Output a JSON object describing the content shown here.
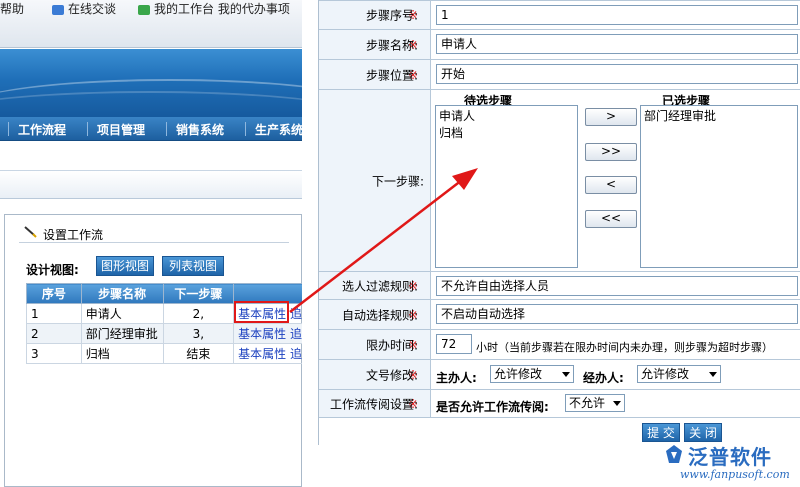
{
  "left_app": {
    "toolbar": {
      "item1": "帮助",
      "item2": "在线交谈",
      "item3": "我的工作台  我的代办事项"
    },
    "nav": {
      "items": [
        "工作流程",
        "项目管理",
        "销售系统",
        "生产系统"
      ]
    },
    "panel": {
      "title": "设置工作流",
      "view_label": "设计视图:",
      "graph_view_button": "图形视图",
      "list_view_button": "列表视图",
      "table": {
        "headers": [
          "序号",
          "步骤名称",
          "下一步骤",
          ""
        ],
        "rows": [
          {
            "no": "1",
            "name": "申请人",
            "next": "2,",
            "link1": "基本属性",
            "link2": "追"
          },
          {
            "no": "2",
            "name": "部门经理审批",
            "next": "3,",
            "link1": "基本属性",
            "link2": "追"
          },
          {
            "no": "3",
            "name": "归档",
            "next": "结束",
            "link1": "基本属性",
            "link2": "追"
          }
        ]
      }
    }
  },
  "form": {
    "step_no": {
      "label": "步骤序号:",
      "value": "1"
    },
    "step_name": {
      "label": "步骤名称:",
      "value": "申请人"
    },
    "step_pos": {
      "label": "步骤位置:",
      "value": "开始"
    },
    "next_step": {
      "label": "下一步骤:",
      "available_header": "待选步骤",
      "selected_header": "已选步骤",
      "available": [
        "申请人",
        "归档"
      ],
      "selected": [
        "部门经理审批"
      ],
      "btn_add": ">",
      "btn_add_all": ">>",
      "btn_remove": "<",
      "btn_remove_all": "<<"
    },
    "filter_rule": {
      "label": "选人过滤规则:",
      "value": "不允许自由选择人员"
    },
    "auto_select": {
      "label": "自动选择规则:",
      "value": "不启动自动选择"
    },
    "time_limit": {
      "label": "限办时间:",
      "value": "72",
      "suffix": "小时（当前步骤若在限办时间内未办理，则步骤为超时步骤）"
    },
    "doc_edit": {
      "label": "文号修改:",
      "host_label": "主办人:",
      "host_value": "允许修改",
      "co_label": "经办人:",
      "co_value": "允许修改"
    },
    "circulate": {
      "label": "工作流传阅设置:",
      "question": "是否允许工作流传阅:",
      "value": "不允许"
    },
    "submit_button": "提 交",
    "close_button": "关 闭",
    "required_mark": "※"
  },
  "watermark": {
    "brand": "泛普软件",
    "url": "www.fanpusoft.com"
  },
  "colors": {
    "accent_blue": "#1e64a8",
    "required_red": "#e01818",
    "annotation_red": "#e01818"
  }
}
